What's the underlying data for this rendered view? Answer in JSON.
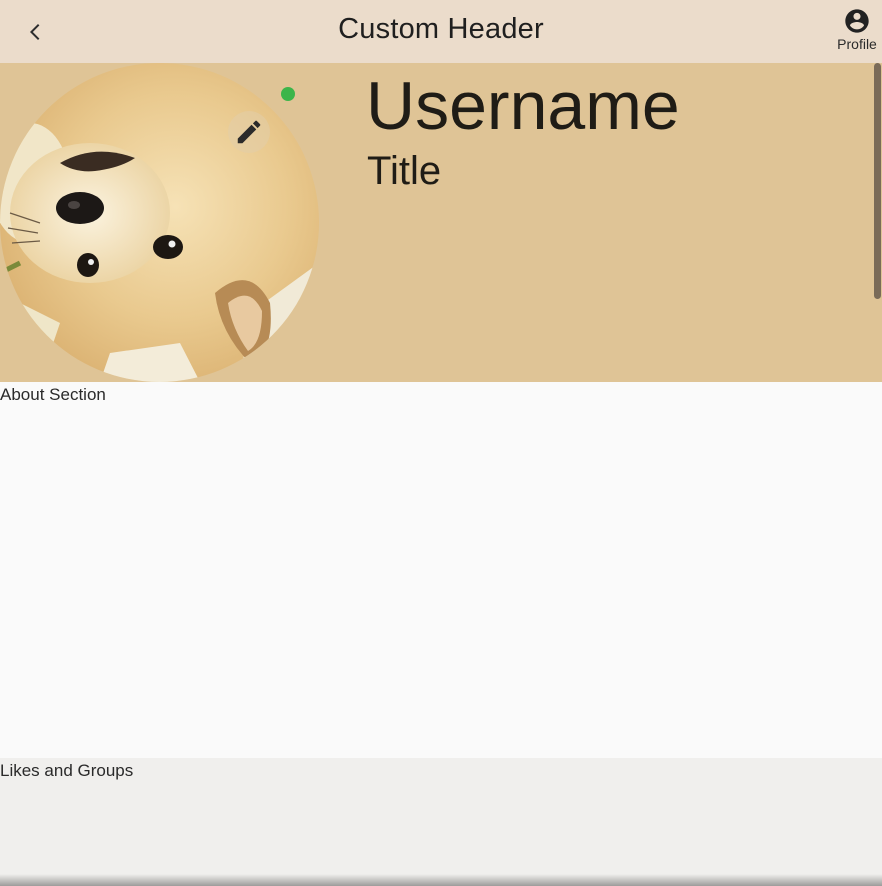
{
  "header": {
    "title": "Custom Header",
    "back_icon": "chevron-left-icon",
    "profile_icon": "account-circle-icon",
    "profile_label": "Profile",
    "background": "#ebdccb"
  },
  "profile": {
    "username": "Username",
    "title": "Title",
    "avatar_icon": "shiba-doge-photo",
    "edit_icon": "pencil-icon",
    "online_status_color": "#3cb54a",
    "banner_background": "#dfc496"
  },
  "sections": {
    "about_label": "About Section",
    "likes_label": "Likes and Groups"
  }
}
